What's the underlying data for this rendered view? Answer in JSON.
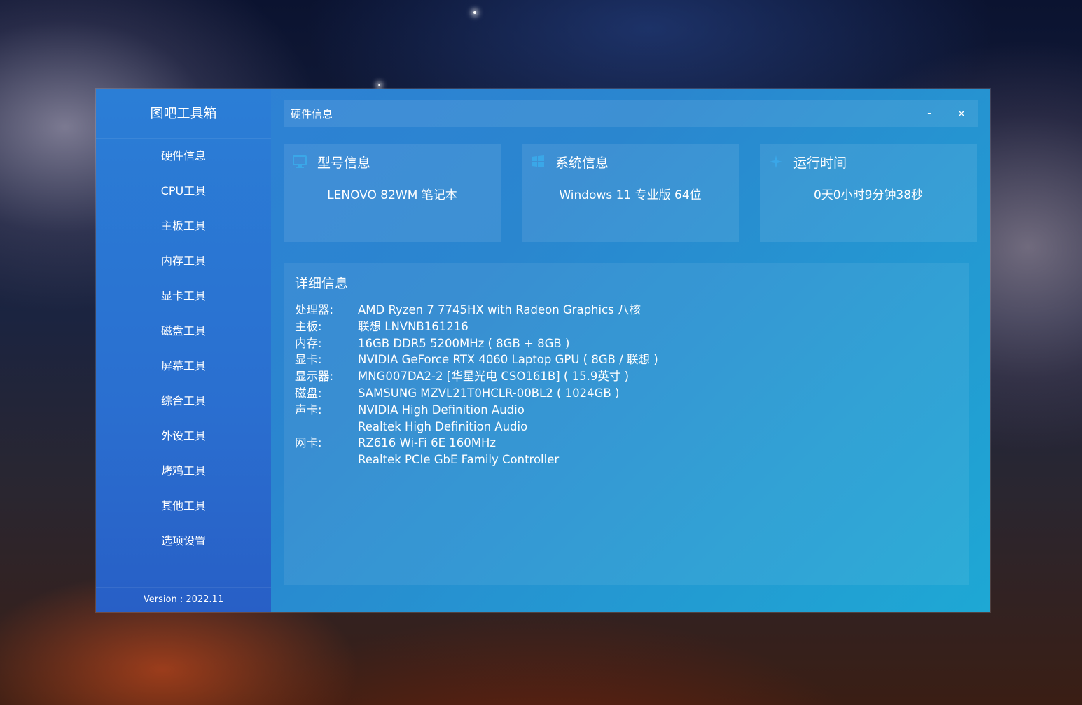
{
  "sidebar": {
    "app_title": "图吧工具箱",
    "items": [
      {
        "label": "硬件信息"
      },
      {
        "label": "CPU工具"
      },
      {
        "label": "主板工具"
      },
      {
        "label": "内存工具"
      },
      {
        "label": "显卡工具"
      },
      {
        "label": "磁盘工具"
      },
      {
        "label": "屏幕工具"
      },
      {
        "label": "综合工具"
      },
      {
        "label": "外设工具"
      },
      {
        "label": "烤鸡工具"
      },
      {
        "label": "其他工具"
      },
      {
        "label": "选项设置"
      }
    ],
    "version": "Version : 2022.11"
  },
  "titlebar": {
    "title": "硬件信息",
    "minimize_label": "-",
    "close_label": "×"
  },
  "cards": {
    "model": {
      "title": "型号信息",
      "value": "LENOVO 82WM 笔记本",
      "icon": "monitor-icon"
    },
    "system": {
      "title": "系统信息",
      "value": "Windows 11 专业版 64位",
      "icon": "windows-icon"
    },
    "uptime": {
      "title": "运行时间",
      "value": "0天0小时9分钟38秒",
      "icon": "sparkle-icon"
    }
  },
  "details": {
    "title": "详细信息",
    "rows": [
      {
        "label": "处理器:",
        "values": [
          "AMD Ryzen 7 7745HX with Radeon Graphics 八核"
        ]
      },
      {
        "label": "主板:",
        "values": [
          "联想 LNVNB161216"
        ]
      },
      {
        "label": "内存:",
        "values": [
          "16GB DDR5 5200MHz ( 8GB + 8GB )"
        ]
      },
      {
        "label": "显卡:",
        "values": [
          "NVIDIA GeForce RTX 4060 Laptop GPU ( 8GB / 联想 )"
        ]
      },
      {
        "label": "显示器:",
        "values": [
          "MNG007DA2-2 [华星光电 CSO161B] ( 15.9英寸 )"
        ]
      },
      {
        "label": "磁盘:",
        "values": [
          "SAMSUNG MZVL21T0HCLR-00BL2 ( 1024GB )"
        ]
      },
      {
        "label": "声卡:",
        "values": [
          "NVIDIA High Definition Audio",
          "Realtek High Definition Audio"
        ]
      },
      {
        "label": "网卡:",
        "values": [
          "RZ616 Wi-Fi 6E 160MHz",
          "Realtek PCIe GbE Family Controller"
        ]
      }
    ]
  },
  "colors": {
    "sidebar_bg": "#2a6fd0",
    "window_accent": "#1ea8d4",
    "icon_blue": "#3aa7e8"
  }
}
